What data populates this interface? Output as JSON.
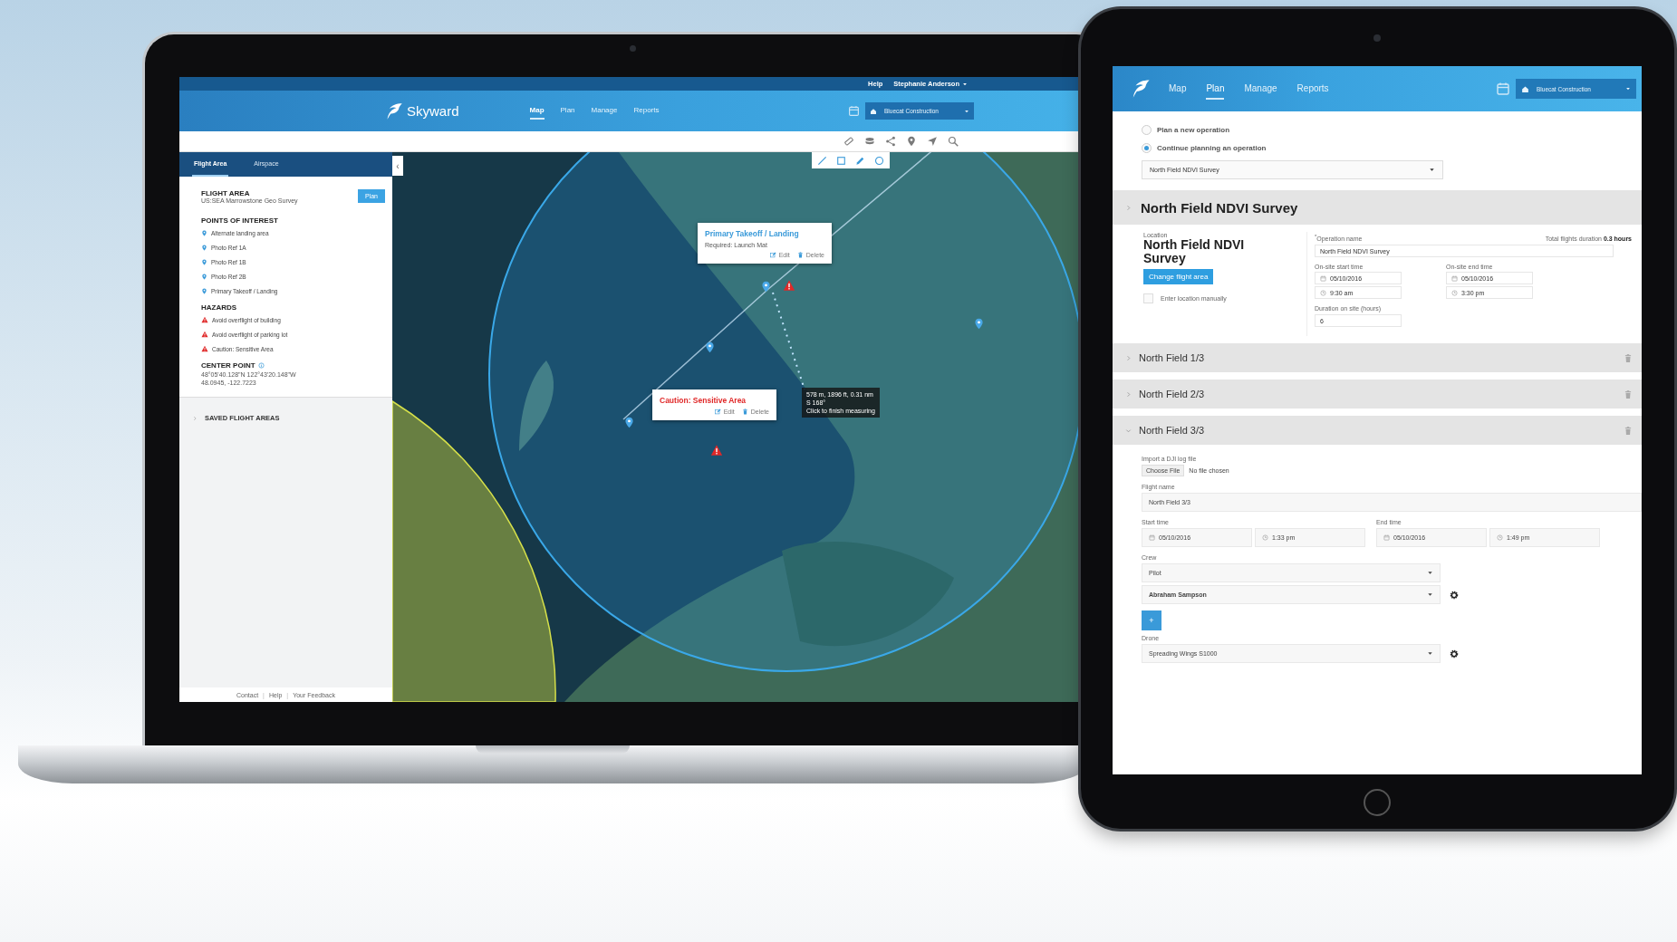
{
  "laptop": {
    "top_links": [
      {
        "kind": "link",
        "label": "Help"
      },
      {
        "kind": "user",
        "label": "Stephanie Anderson"
      }
    ],
    "brand": "Skyward",
    "nav": [
      {
        "label": "Map",
        "selected": true
      },
      {
        "label": "Plan",
        "selected": false
      },
      {
        "label": "Manage",
        "selected": false
      },
      {
        "label": "Reports",
        "selected": false
      }
    ],
    "organization": "Bluecat Construction",
    "sidebar": {
      "tabs": [
        {
          "label": "Flight Area",
          "selected": true
        },
        {
          "label": "Airspace",
          "selected": false
        }
      ],
      "flight_area": {
        "heading": "FLIGHT AREA",
        "name": "US:SEA Marrowstone Geo Survey",
        "button": "Plan"
      },
      "points_heading": "POINTS OF INTEREST",
      "points": [
        "Alternate landing area",
        "Photo Ref 1A",
        "Photo Ref 1B",
        "Photo Ref 2B",
        "Primary Takeoff / Landing"
      ],
      "hazards_heading": "HAZARDS",
      "hazards": [
        "Avoid overflight of building",
        "Avoid overflight of parking lot",
        "Caution: Sensitive Area"
      ],
      "center_point": {
        "heading": "CENTER POINT",
        "dms": "48°05'40.128\"N 122°43'20.148\"W",
        "decimal": "48.0945, -122.7223"
      },
      "saved_heading": "SAVED FLIGHT AREAS",
      "footer": [
        {
          "kind": "link",
          "text": "Contact"
        },
        {
          "kind": "separator",
          "text": "|"
        },
        {
          "kind": "link",
          "text": "Help"
        },
        {
          "kind": "separator",
          "text": "|"
        },
        {
          "kind": "link",
          "text": "Your Feedback"
        }
      ]
    },
    "collapse_button": "‹",
    "map": {
      "popups": [
        {
          "kind": "point",
          "title": "Primary Takeoff / Landing",
          "note": "Required: Launch Mat",
          "actions": [
            "Edit",
            "Delete"
          ]
        },
        {
          "kind": "hazard",
          "title": "Caution: Sensitive Area",
          "actions": [
            "Edit",
            "Delete"
          ]
        }
      ],
      "measure_tooltip": [
        "578 m, 1896 ft, 0.31 nm",
        "S 168°",
        "Click to finish measuring"
      ]
    }
  },
  "tablet": {
    "nav": [
      {
        "label": "Map",
        "selected": false
      },
      {
        "label": "Plan",
        "selected": true
      },
      {
        "label": "Manage",
        "selected": false
      },
      {
        "label": "Reports",
        "selected": false
      }
    ],
    "organization": "Bluecat Construction",
    "operation_choice": [
      {
        "label": "Plan a new operation",
        "selected": false
      },
      {
        "label": "Continue planning an operation",
        "selected": true
      }
    ],
    "operation_select": "North Field NDVI Survey",
    "operation_title": "North Field NDVI Survey",
    "location": {
      "label": "Location",
      "name": "North Field NDVI Survey",
      "button": "Change flight area",
      "manual": {
        "label": "Enter location manually",
        "checked": false
      }
    },
    "details": {
      "name_label": "$^{*}$Operation name",
      "name_value": "North Field NDVI Survey",
      "total": "Total flights duration **0.3 hours**",
      "start_label": "On-site start time",
      "start_date": "05/10/2016",
      "start_time": "9:30 am",
      "end_label": "On-site end time",
      "end_date": "05/10/2016",
      "end_time": "3:30 pm",
      "duration_label": "Duration on site (hours)",
      "duration_value": "6"
    },
    "flights": [
      {
        "title": "North Field 1/3",
        "expanded": false
      },
      {
        "title": "North Field 2/3",
        "expanded": false
      },
      {
        "title": "North Field 3/3",
        "expanded": true
      }
    ],
    "flight_form": {
      "import_label": "Import a DJI log file",
      "file_button": "Choose File",
      "file_status": "No file chosen",
      "name_label": "Flight name",
      "name_value": "North Field 3/3",
      "start_label": "Start time",
      "start_date": "05/10/2016",
      "start_time": "1:33 pm",
      "end_label": "End time",
      "end_date": "05/10/2016",
      "end_time": "1:49 pm",
      "crew_label": "Crew",
      "crew_role": "Pilot",
      "crew_member": "Abraham Sampson",
      "add_button": "+",
      "drone_label": "Drone",
      "drone": "Spreading Wings S1000"
    }
  }
}
